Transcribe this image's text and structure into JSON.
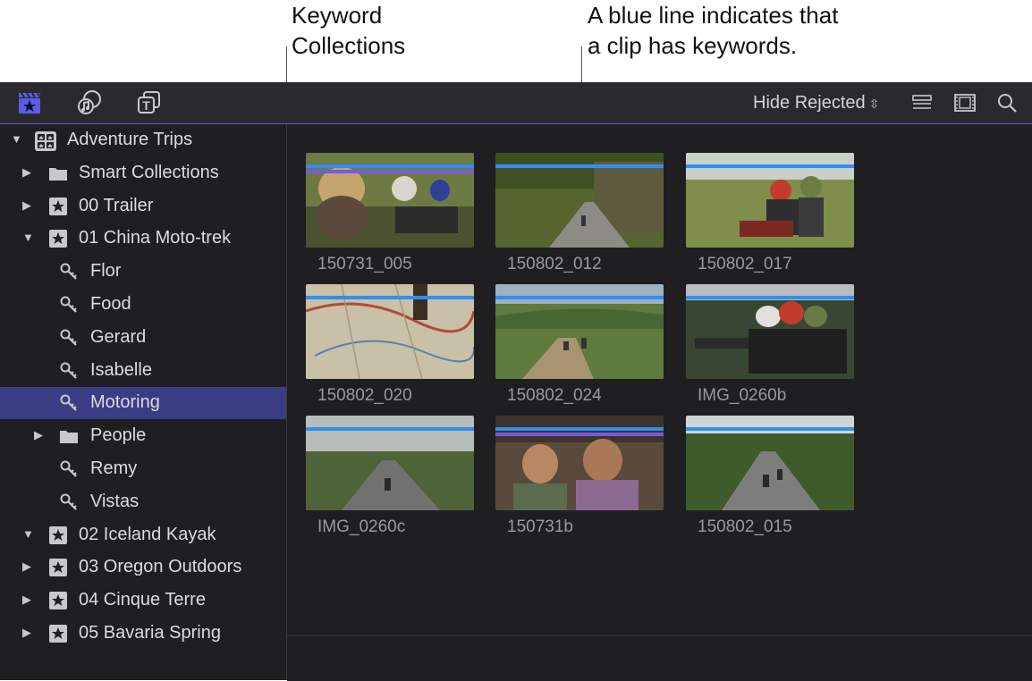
{
  "callouts": {
    "keyword_collections": "Keyword\nCollections",
    "blue_line": "A blue line indicates that\na clip has keywords."
  },
  "toolbar": {
    "library_icon": "clapper-star-icon",
    "photos_icon": "music-photo-icon",
    "titles_icon": "titles-icon",
    "filter_label": "Hide Rejected",
    "list_icon": "list-view-icon",
    "filmstrip_icon": "filmstrip-icon",
    "search_icon": "search-icon"
  },
  "sidebar": {
    "items": [
      {
        "label": "Adventure Trips",
        "icon": "library-icon",
        "disclosure": "open",
        "indent": 0
      },
      {
        "label": "Smart Collections",
        "icon": "folder-icon",
        "disclosure": "closed",
        "indent": 1
      },
      {
        "label": "00 Trailer",
        "icon": "event-star-icon",
        "disclosure": "closed",
        "indent": 1
      },
      {
        "label": "01 China Moto-trek",
        "icon": "event-star-icon",
        "disclosure": "open",
        "indent": 1
      },
      {
        "label": "Flor",
        "icon": "keyword-icon",
        "disclosure": "none",
        "indent": 2
      },
      {
        "label": "Food",
        "icon": "keyword-icon",
        "disclosure": "none",
        "indent": 2
      },
      {
        "label": "Gerard",
        "icon": "keyword-icon",
        "disclosure": "none",
        "indent": 2
      },
      {
        "label": "Isabelle",
        "icon": "keyword-icon",
        "disclosure": "none",
        "indent": 2
      },
      {
        "label": "Motoring",
        "icon": "keyword-icon",
        "disclosure": "none",
        "indent": 2,
        "selected": true
      },
      {
        "label": "People",
        "icon": "folder-icon",
        "disclosure": "closed",
        "indent": 2
      },
      {
        "label": "Remy",
        "icon": "keyword-icon",
        "disclosure": "none",
        "indent": 2
      },
      {
        "label": "Vistas",
        "icon": "keyword-icon",
        "disclosure": "none",
        "indent": 2
      },
      {
        "label": "02 Iceland Kayak",
        "icon": "event-star-icon",
        "disclosure": "open",
        "indent": 1
      },
      {
        "label": "03 Oregon Outdoors",
        "icon": "event-star-icon",
        "disclosure": "closed",
        "indent": 1
      },
      {
        "label": "04 Cinque Terre",
        "icon": "event-star-icon",
        "disclosure": "closed",
        "indent": 1
      },
      {
        "label": "05 Bavaria Spring",
        "icon": "event-star-icon",
        "disclosure": "closed",
        "indent": 1
      }
    ]
  },
  "clips": [
    {
      "name": "150731_005",
      "scene": "riders-closeup",
      "second_line": true
    },
    {
      "name": "150802_012",
      "scene": "cliff-road",
      "second_line": false
    },
    {
      "name": "150802_017",
      "scene": "two-riders",
      "second_line": false
    },
    {
      "name": "150802_020",
      "scene": "map",
      "second_line": false
    },
    {
      "name": "150802_024",
      "scene": "valley-road",
      "second_line": false
    },
    {
      "name": "IMG_0260b",
      "scene": "riders-dark",
      "second_line": false
    },
    {
      "name": "IMG_0260c",
      "scene": "wet-road",
      "second_line": false
    },
    {
      "name": "150731b",
      "scene": "people-talking",
      "second_line": true
    },
    {
      "name": "150802_015",
      "scene": "forest-road",
      "second_line": false
    }
  ],
  "colors": {
    "keyword_line": "#2f8ff2",
    "secondary_line": "#7b5ad6",
    "selection": "#3a3d84",
    "accent": "#5c57d6"
  }
}
